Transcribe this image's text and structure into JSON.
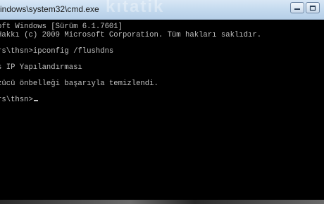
{
  "window": {
    "title": "indows\\system32\\cmd.exe",
    "watermark": "kıtatik"
  },
  "console": {
    "lines": [
      "oft Windows [Sürüm 6.1.7601]",
      "Hakkı (c) 2009 Microsoft Corporation. Tüm hakları saklıdır.",
      "",
      "rs\\thsn>ipconfig /flushdns",
      "",
      "s IP Yapılandırması",
      "",
      "zücü önbelleği başarıyla temizlendi.",
      "",
      "rs\\thsn>"
    ]
  },
  "icons": {
    "minimize": "minimize-icon",
    "maximize": "maximize-icon",
    "close": "close-icon"
  }
}
